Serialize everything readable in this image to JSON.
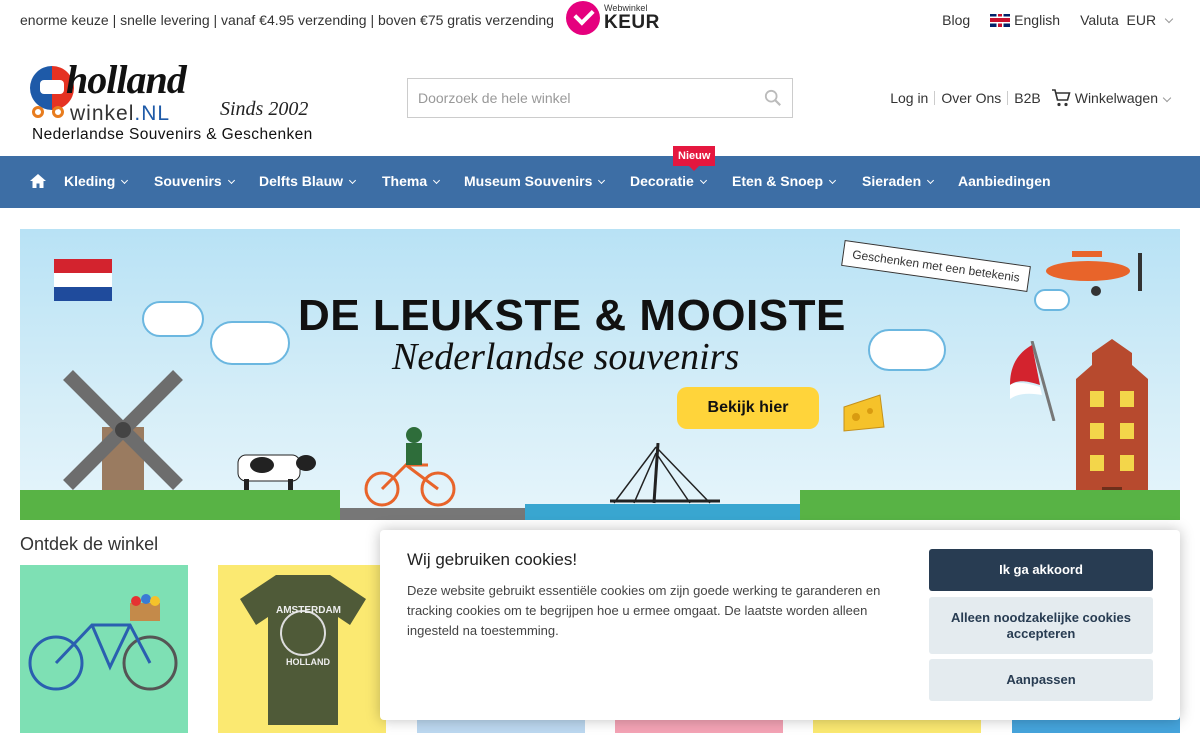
{
  "topbar": {
    "usp": "enorme keuze | snelle levering | vanaf €4.95 verzending | boven €75 gratis verzending",
    "keur_small": "Webwinkel",
    "keur_big": "KEUR",
    "blog": "Blog",
    "language": "English",
    "valuta_label": "Valuta",
    "valuta_value": "EUR"
  },
  "logo": {
    "holland": "holland",
    "winkel": "winkel",
    "nl": ".NL",
    "sinds": "Sinds 2002",
    "tagline": "Nederlandse Souvenirs & Geschenken"
  },
  "search": {
    "placeholder": "Doorzoek de hele winkel"
  },
  "header_links": {
    "login": "Log in",
    "over_ons": "Over Ons",
    "b2b": "B2B",
    "cart": "Winkelwagen"
  },
  "nav": {
    "items": [
      "Kleding",
      "Souvenirs",
      "Delfts Blauw",
      "Thema",
      "Museum Souvenirs",
      "Decoratie",
      "Eten & Snoep",
      "Sieraden",
      "Aanbiedingen"
    ],
    "badge": "Nieuw"
  },
  "banner": {
    "headline": "DE LEUKSTE & MOOISTE",
    "subline": "Nederlandse souvenirs",
    "cta": "Bekijk hier",
    "ribbon": "Geschenken met een betekenis"
  },
  "section": {
    "title": "Ontdek de winkel"
  },
  "tiles": [
    {
      "name": "fiets",
      "color": "#7ee0b4"
    },
    {
      "name": "shirt",
      "color": "#fbe971"
    },
    {
      "name": "tile-3",
      "color": "#bcd8f0"
    },
    {
      "name": "tile-4",
      "color": "#f4a3b5"
    },
    {
      "name": "tile-5",
      "color": "#fbe971"
    },
    {
      "name": "tile-6",
      "color": "#45a4dc"
    }
  ],
  "shirt_text": {
    "top": "AMSTERDAM",
    "bottom": "HOLLAND"
  },
  "cookie": {
    "title": "Wij gebruiken cookies!",
    "text": "Deze website gebruikt essentiële cookies om zijn goede werking te garanderen en tracking cookies om te begrijpen hoe u ermee omgaat. De laatste worden alleen ingesteld na toestemming.",
    "accept": "Ik ga akkoord",
    "necessary": "Alleen noodzakelijke cookies accepteren",
    "customize": "Aanpassen"
  }
}
